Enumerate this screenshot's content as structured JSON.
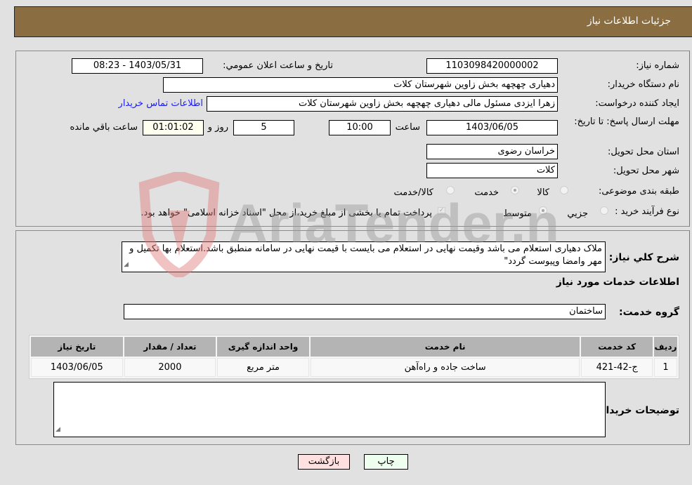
{
  "header": {
    "title": "جزئیات اطلاعات نیاز"
  },
  "form": {
    "need_number": {
      "label": "شماره نیاز:",
      "value": "1103098420000002"
    },
    "announce_datetime": {
      "label": "تاریخ و ساعت اعلان عمومي:",
      "value": "1403/05/31 - 08:23"
    },
    "buyer_org": {
      "label": "نام دستگاه خریدار:",
      "value": "دهیاری چهچهه بخش زاوین شهرستان کلات"
    },
    "requester": {
      "label": "ایجاد کننده درخواست:",
      "value": "زهرا ایزدی مسئول مالی دهیاری چهچهه بخش زاوین شهرستان کلات",
      "contact_link": "اطلاعات تماس خریدار"
    },
    "deadline": {
      "label": "مهلت ارسال پاسخ: تا تاریخ:",
      "date": "1403/06/05",
      "time_label": "ساعت",
      "time": "10:00",
      "days": "5",
      "days_label": "روز و",
      "remaining": "01:01:02",
      "remaining_label": "ساعت باقي مانده"
    },
    "province": {
      "label": "استان محل تحویل:",
      "value": "خراسان رضوی"
    },
    "city": {
      "label": "شهر محل تحویل:",
      "value": "کلات"
    },
    "category": {
      "label": "طبقه بندی موضوعی:",
      "options": [
        "کالا",
        "خدمت",
        "کالا/خدمت"
      ],
      "selected": "خدمت"
    },
    "purchase_type": {
      "label": "نوع فرآیند خرید :",
      "options": [
        "جزيي",
        "متوسط"
      ],
      "selected": "متوسط",
      "treasury_note": "پرداخت تمام یا بخشی از مبلغ خرید،از محل \"اسناد خزانه اسلامی\" خواهد بود.",
      "treasury_checked": true
    }
  },
  "description": {
    "label": "شرح کلي نیاز:",
    "value": "ملاک دهیاری استعلام می باشد وقیمت نهایی در استعلام می بایست با قیمت نهایی در سامانه منطبق باشد.استعلام بها تکمیل و مهر وامضا وپیوست گردد\""
  },
  "services": {
    "section_title": "اطلاعات خدمات مورد نیاز",
    "group_label": "گروه خدمت:",
    "group_value": "ساختمان",
    "table": {
      "columns": [
        "ردیف",
        "کد خدمت",
        "نام خدمت",
        "واحد اندازه گیری",
        "تعداد / مقدار",
        "تاریخ نیاز"
      ],
      "rows": [
        [
          "1",
          "ج-42-421",
          "ساخت جاده و راه‌آهن",
          "متر مربع",
          "2000",
          "1403/06/05"
        ]
      ]
    }
  },
  "buyer_notes": {
    "label": "توضیحات خریدار:",
    "value": ""
  },
  "buttons": {
    "print": "چاپ",
    "back": "بازگشت"
  },
  "watermark": {
    "text": "AriaTender.neT"
  },
  "colors": {
    "header_bg": "#8b6d42",
    "link": "#1a1aff",
    "print_bg": "#efffef",
    "back_bg": "#ffe0e0",
    "remaining_bg": "#fffff0"
  }
}
